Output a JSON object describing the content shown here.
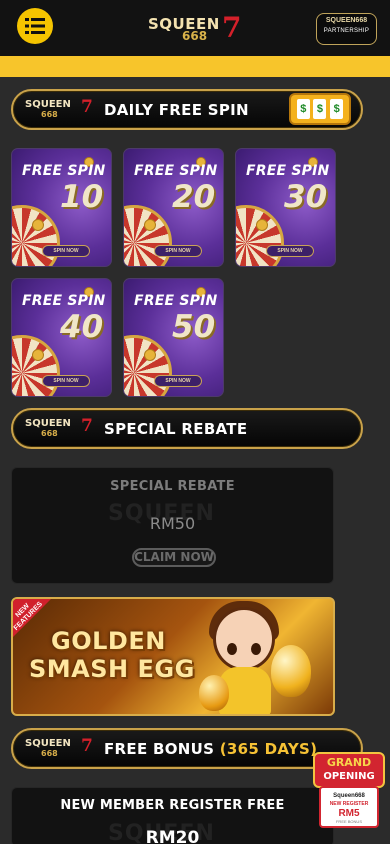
{
  "header": {
    "menu_icon": "list-menu-icon",
    "logo": {
      "word": "SQUEEN",
      "digits": "668",
      "mark": "7"
    },
    "partnership": {
      "logo_word": "SQUEEN668",
      "label": "PARTNERSHIP"
    }
  },
  "colors": {
    "accent": "#f7c52b",
    "gold_border": "#c9a24a",
    "brand_red": "#d4202a",
    "background": "#2b2b2b"
  },
  "sections": {
    "daily_spin": {
      "logo_word": "SQUEEN",
      "logo_digits": "668",
      "logo_mark": "7",
      "title": "DAILY FREE SPIN",
      "slot_symbols": [
        "$",
        "$",
        "$"
      ]
    },
    "special_rebate": {
      "logo_word": "SQUEEN",
      "logo_digits": "668",
      "logo_mark": "7",
      "title": "SPECIAL REBATE"
    },
    "free_bonus": {
      "logo_word": "SQUEEN",
      "logo_digits": "668",
      "logo_mark": "7",
      "title": "FREE BONUS",
      "title_accent": "(365 DAYS)"
    }
  },
  "spins": [
    {
      "label": "FREE SPIN",
      "number": "10",
      "button": "SPIN NOW"
    },
    {
      "label": "FREE SPIN",
      "number": "20",
      "button": "SPIN NOW"
    },
    {
      "label": "FREE SPIN",
      "number": "30",
      "button": "SPIN NOW"
    },
    {
      "label": "FREE SPIN",
      "number": "40",
      "button": "SPIN NOW"
    },
    {
      "label": "FREE SPIN",
      "number": "50",
      "button": "SPIN NOW"
    }
  ],
  "rebate_card": {
    "title": "SPECIAL REBATE",
    "watermark": "SQUEEN",
    "amount": "RM50",
    "button": "CLAIM NOW"
  },
  "promo_egg": {
    "ribbon": "NEW FEATURES",
    "line1": "GOLDEN",
    "line2": "SMASH EGG"
  },
  "grand_opening": {
    "line1": "GRAND",
    "line2": "OPENING",
    "brand": "Squeen668",
    "caption": "NEW REGISTER",
    "amount": "RM5",
    "fine": "FREE BONUS"
  },
  "bonus_card": {
    "title": "NEW MEMBER REGISTER FREE",
    "watermark": "SQUEEN",
    "amount": "RM20"
  }
}
